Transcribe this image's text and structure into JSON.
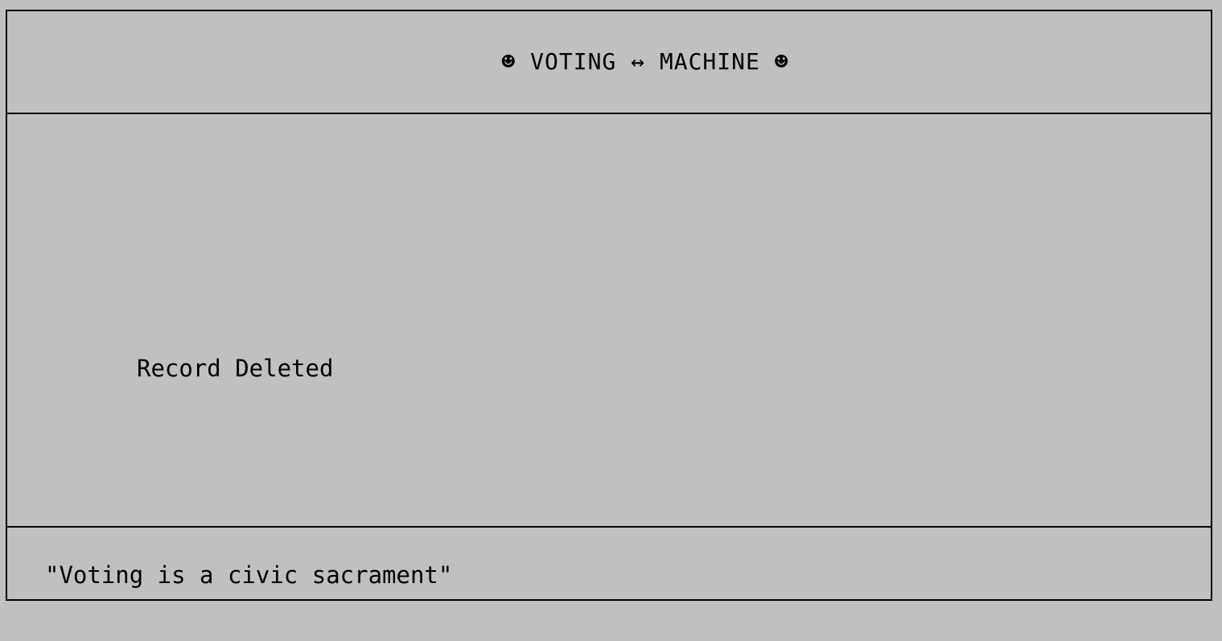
{
  "header": {
    "title": "☻ VOTING ↔ MACHINE ☻"
  },
  "content": {
    "message": "Record Deleted"
  },
  "footer": {
    "quote": "\"Voting is a civic sacrament\""
  }
}
